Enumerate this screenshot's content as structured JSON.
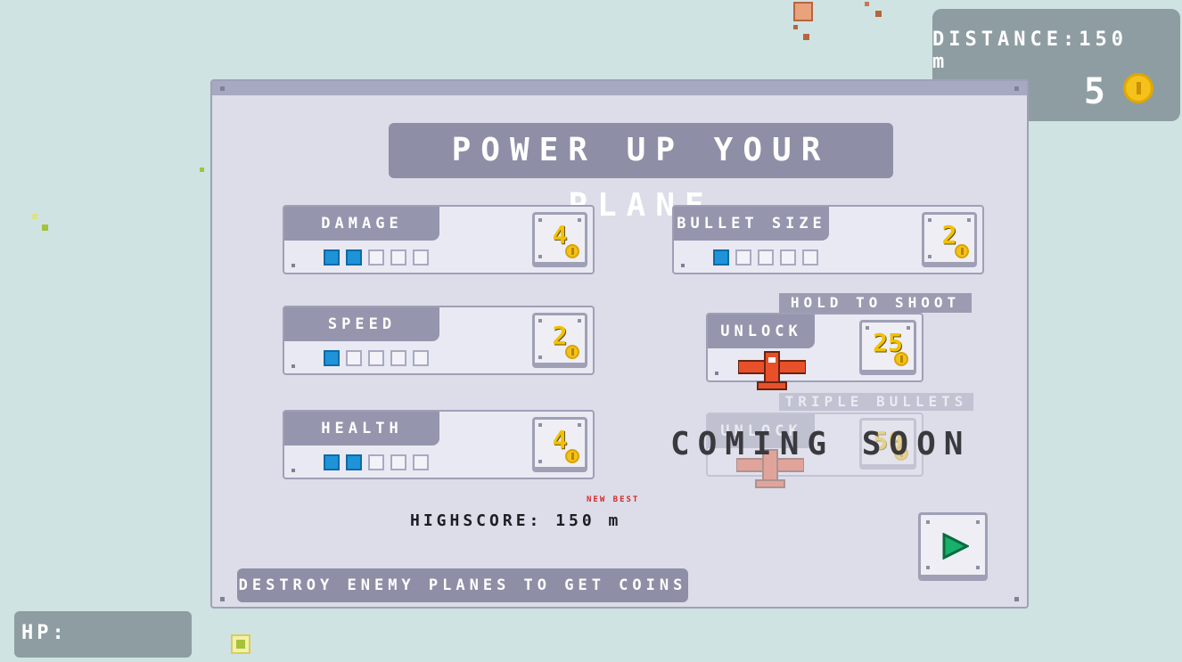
{
  "hud": {
    "distance": "DISTANCE:150 m",
    "coins": "5",
    "hp_label": "HP:"
  },
  "title": "POWER UP YOUR PLANE",
  "upgrades": [
    {
      "label": "DAMAGE",
      "level": 2,
      "max": 5,
      "cost": "4"
    },
    {
      "label": "BULLET SIZE",
      "level": 1,
      "max": 5,
      "cost": "2"
    },
    {
      "label": "SPEED",
      "level": 1,
      "max": 5,
      "cost": "2"
    },
    {
      "label": "HEALTH",
      "level": 2,
      "max": 5,
      "cost": "4"
    }
  ],
  "unlocks": [
    {
      "hint": "HOLD TO SHOOT",
      "label": "UNLOCK",
      "cost": "25"
    },
    {
      "hint": "TRIPLE BULLETS",
      "label": "UNLOCK",
      "cost": "50"
    }
  ],
  "coming_soon": "COMING SOON",
  "highscore": "HIGHSCORE: 150 m",
  "new_best": "NEW BEST",
  "tip": "DESTROY ENEMY PLANES TO GET COINS",
  "colors": {
    "pip_on": "#1f93d8",
    "coin": "#f4c21a",
    "plane": "#e8502a",
    "play": "#18b06a"
  },
  "icons": {
    "coin": "coin-icon",
    "plane": "plane-icon",
    "play": "play-icon"
  }
}
